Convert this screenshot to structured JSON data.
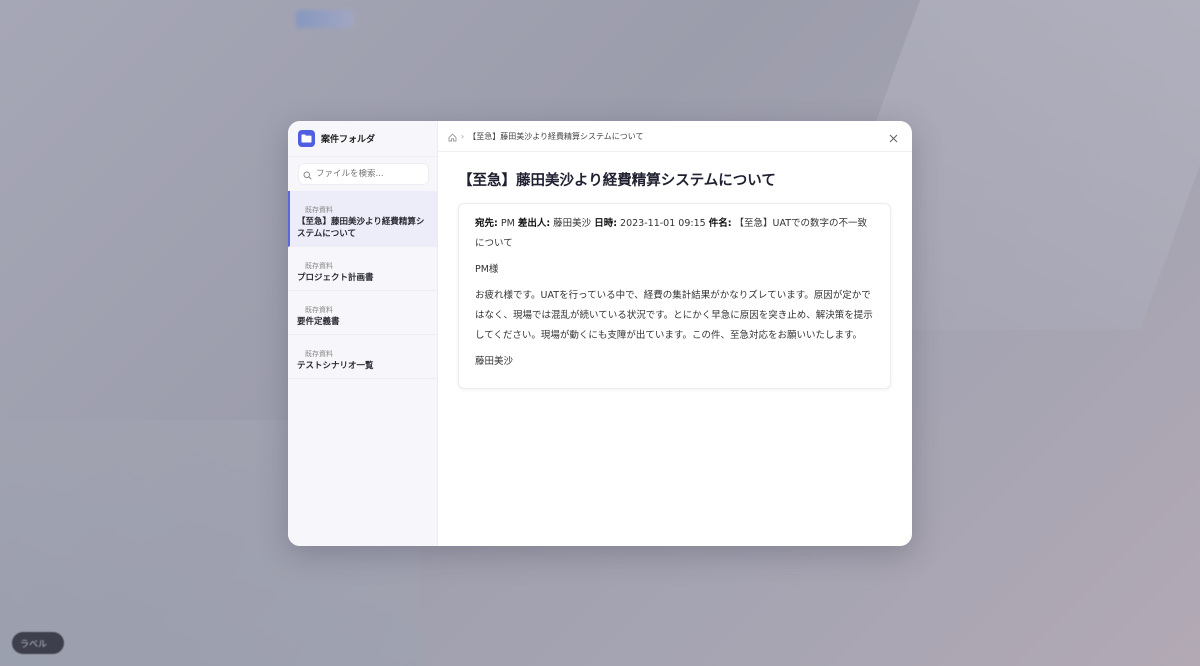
{
  "background": {
    "chip_label": "ラベル"
  },
  "sidebar": {
    "title": "案件フォルダ",
    "search_placeholder": "ファイルを検索...",
    "items": [
      {
        "tag": "既存資料",
        "name": "【至急】藤田美沙より経費精算システムについて",
        "active": true
      },
      {
        "tag": "既存資料",
        "name": "プロジェクト計画書",
        "active": false
      },
      {
        "tag": "既存資料",
        "name": "要件定義書",
        "active": false
      },
      {
        "tag": "既存資料",
        "name": "テストシナリオ一覧",
        "active": false
      }
    ]
  },
  "breadcrumb": {
    "current": "【至急】藤田美沙より経費精算システムについて"
  },
  "document": {
    "title": "【至急】藤田美沙より経費精算システムについて",
    "to_label": "宛先:",
    "to": "PM",
    "from_label": "差出人:",
    "from": "藤田美沙",
    "date_label": "日時:",
    "date": "2023-11-01 09:15",
    "subject_label": "件名:",
    "subject": "【至急】UATでの数字の不一致について",
    "greeting": "PM様",
    "body": "お疲れ様です。UATを行っている中で、経費の集計結果がかなりズレています。原因が定かではなく、現場では混乱が続いている状況です。とにかく早急に原因を突き止め、解決策を提示してください。現場が動くにも支障が出ています。この件、至急対応をお願いいたします。",
    "signature": "藤田美沙"
  },
  "colors": {
    "accent": "#4f5fe0",
    "active_bg": "#ecedf8"
  }
}
